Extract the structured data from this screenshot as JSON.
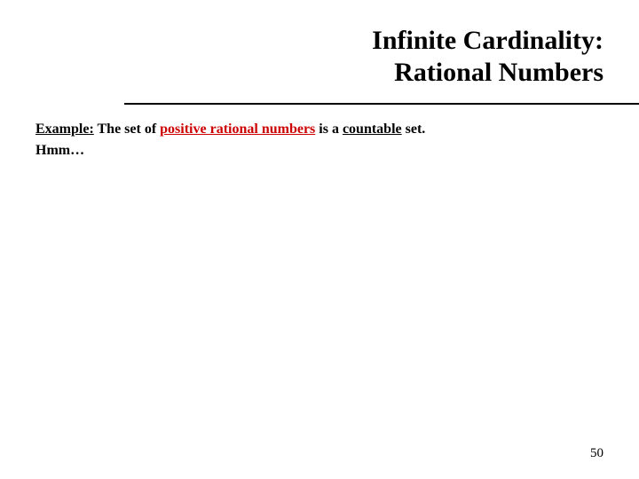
{
  "title": {
    "line1": "Infinite Cardinality:",
    "line2": "Rational Numbers"
  },
  "content": {
    "example_label": "Example:",
    "text1": " The set of ",
    "emph1": "positive rational numbers",
    "text2": " is a ",
    "emph2": "countable",
    "text3": " set.",
    "line2": "Hmm…"
  },
  "page_number": "50"
}
